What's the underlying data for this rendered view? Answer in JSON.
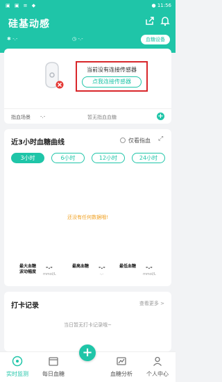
{
  "colors": {
    "accent": "#1fc5a8",
    "highlight": "#d8262a",
    "nodata": "#f0a020"
  },
  "statusbar": {
    "left": "▣ ▣ ≡ ◆",
    "right": "● 11:56"
  },
  "header": {
    "title": "硅基动感",
    "bluetooth_value": "-.-",
    "time_value": "-.-",
    "device_button": "血糖设备"
  },
  "sensor": {
    "status": "当前没有连接传感器",
    "connect_button": "点我连接传感器"
  },
  "fingerstick": {
    "label": "指血场景",
    "value": "-.-",
    "empty": "暂无指血血糖"
  },
  "curve": {
    "title": "近3小时血糖曲线",
    "only_finger": "仅看指血",
    "tabs": [
      "3小时",
      "6小时",
      "12小时",
      "24小时"
    ],
    "no_data": "还没有任何数据哦!",
    "stats": [
      {
        "name1": "最大血糖",
        "name2": "波动幅度",
        "value": "-.-",
        "unit": "mmol/L"
      },
      {
        "name1": "最高血糖",
        "name2": "",
        "value": "-.-",
        "unit": "-.-"
      },
      {
        "name1": "最低血糖",
        "name2": "",
        "value": "-.-",
        "unit": "mmol/L"
      }
    ]
  },
  "checkin": {
    "title": "打卡记录",
    "more": "查看更多 >",
    "empty": "当日暂无打卡记录哦~"
  },
  "tabbar": {
    "items": [
      "实时监测",
      "每日血糖",
      "血糖分析",
      "个人中心"
    ],
    "add": "+"
  }
}
